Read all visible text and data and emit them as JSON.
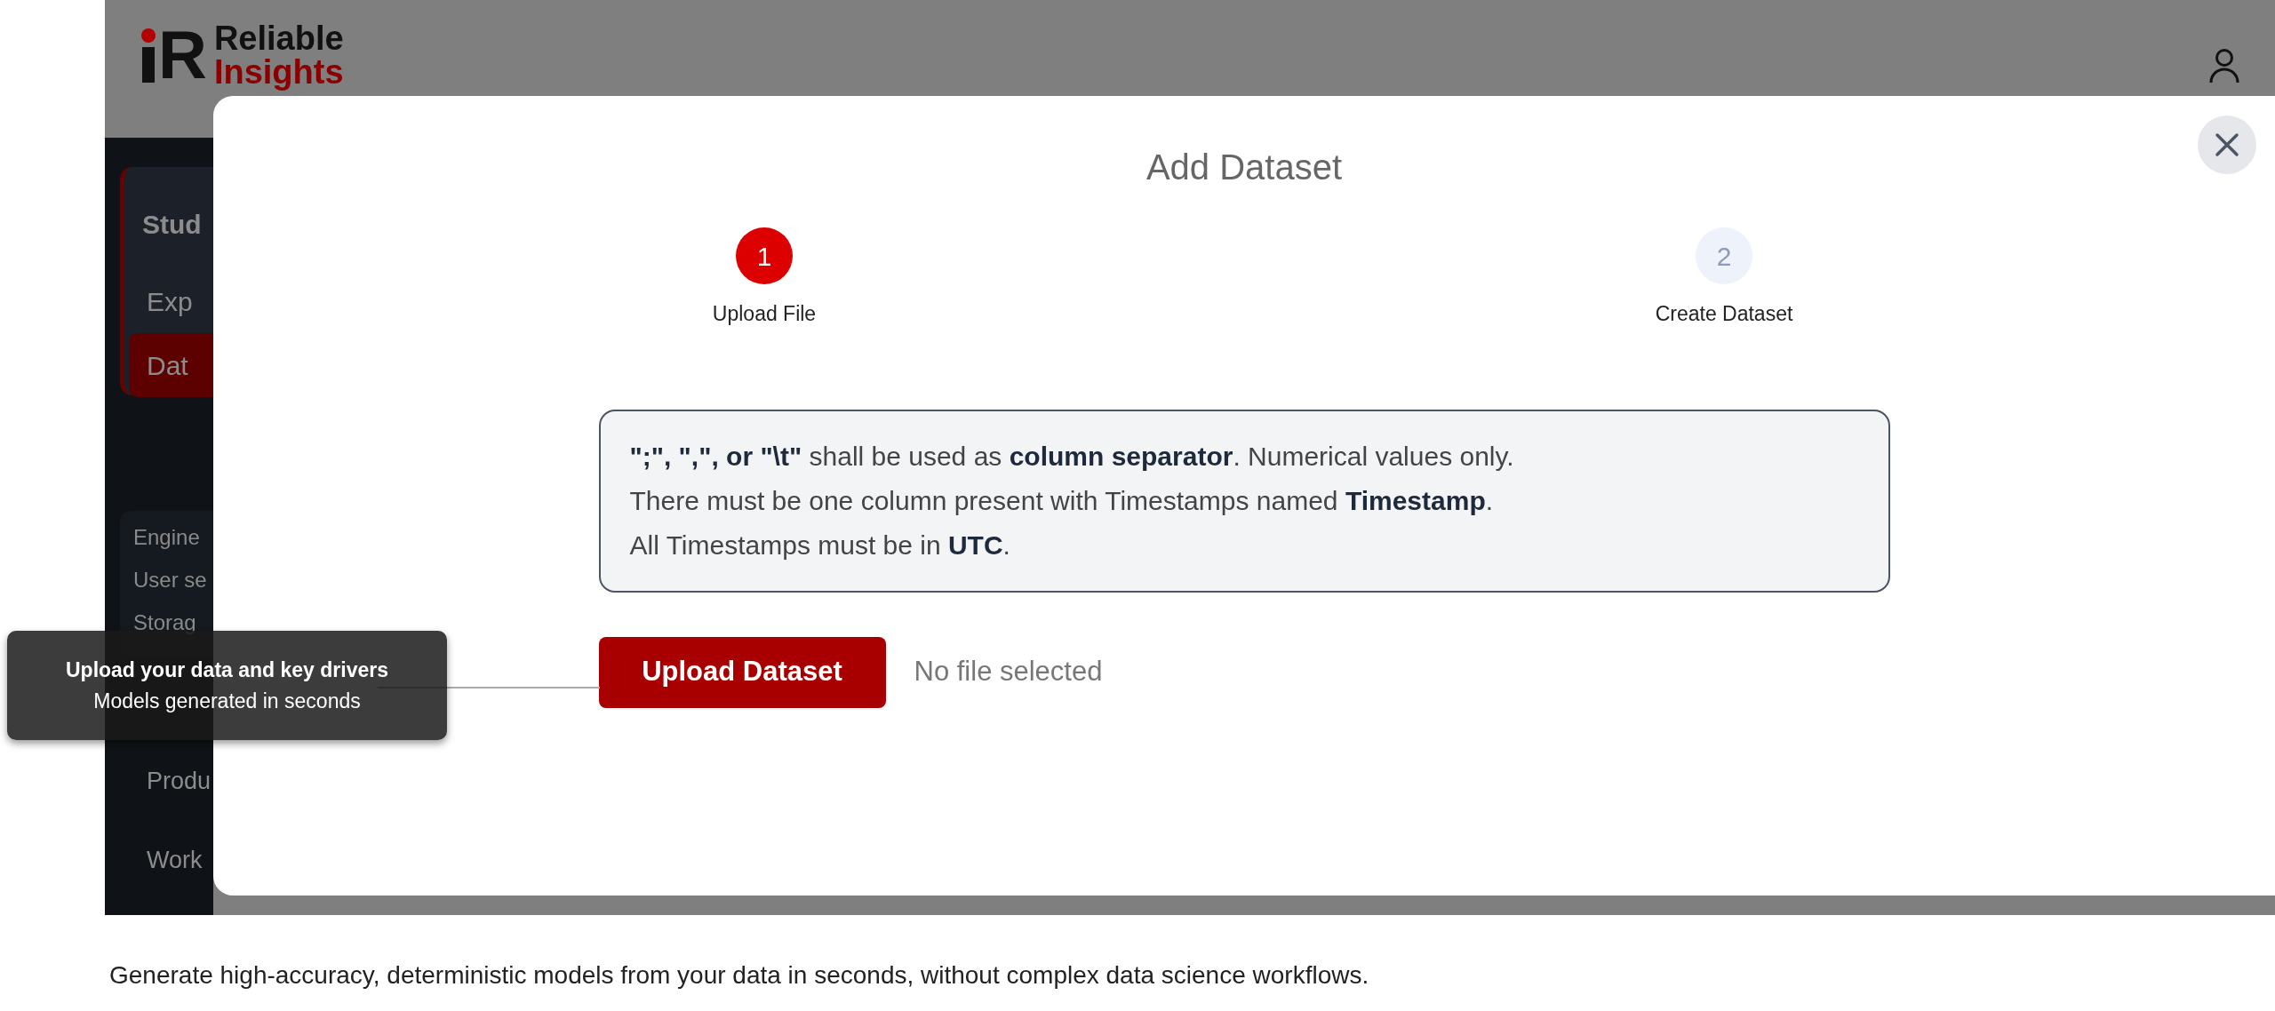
{
  "app": {
    "logo": {
      "mark": "R",
      "line1": "Reliable",
      "line2": "Insights"
    },
    "sidebar": {
      "section_title": "Stud",
      "items": [
        {
          "label": "Exp",
          "selected": false
        },
        {
          "label": "Dat",
          "selected": true
        }
      ],
      "settings": [
        "Engine",
        "User se",
        "Storag"
      ],
      "links": [
        "Produ",
        "Work"
      ]
    }
  },
  "modal": {
    "title": "Add Dataset",
    "steps": [
      {
        "number": "1",
        "label": "Upload File",
        "selected": true
      },
      {
        "number": "2",
        "label": "Create Dataset",
        "selected": false
      }
    ],
    "notes": [
      "**\";\", \",\", or \"\\t\"** shall be used as **column separator**. Numerical values only.",
      "There must be one column present with Timestamps named **Timestamp**.",
      "All Timestamps must be in **UTC**."
    ],
    "upload_button": "Upload Dataset",
    "file_status": "No file selected"
  },
  "tooltip": {
    "title": "Upload your data and key drivers",
    "subtitle": "Models generated in seconds"
  },
  "caption": "Generate high-accuracy, deterministic models from your data in seconds, without complex data science workflows."
}
